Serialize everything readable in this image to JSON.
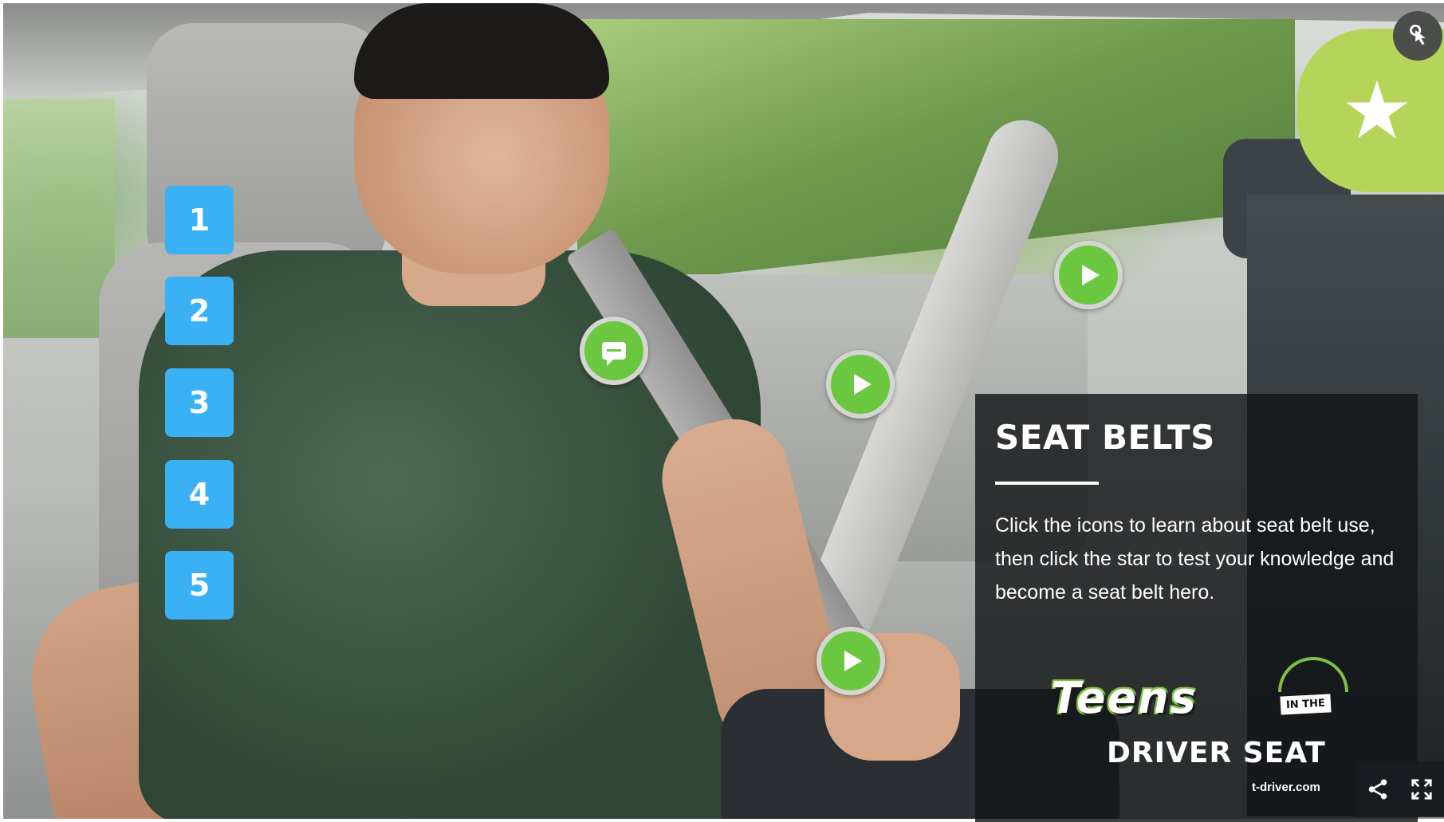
{
  "numbered_items": [
    {
      "label": "1"
    },
    {
      "label": "2"
    },
    {
      "label": "3"
    },
    {
      "label": "4"
    },
    {
      "label": "5"
    }
  ],
  "info_panel": {
    "title": "SEAT BELTS",
    "body": "Click the icons to learn about seat belt use, then click the star to test your knowledge and become a seat belt hero."
  },
  "brand": {
    "teens": "Teens",
    "in_the": "IN THE",
    "driver_seat": "DRIVER SEAT",
    "domain": "t-driver.com"
  },
  "hotspots": [
    {
      "icon": "speech-bubble-icon"
    },
    {
      "icon": "play-icon"
    },
    {
      "icon": "play-icon"
    },
    {
      "icon": "play-icon"
    }
  ],
  "quiz_button": {
    "icon": "star-icon",
    "color": "#b4d55a"
  },
  "colors": {
    "number_button": "#3bb1f5",
    "hotspot": "#6cc740",
    "panel": "#141618"
  },
  "controls": [
    "share-icon",
    "fullscreen-icon",
    "touch-icon"
  ]
}
